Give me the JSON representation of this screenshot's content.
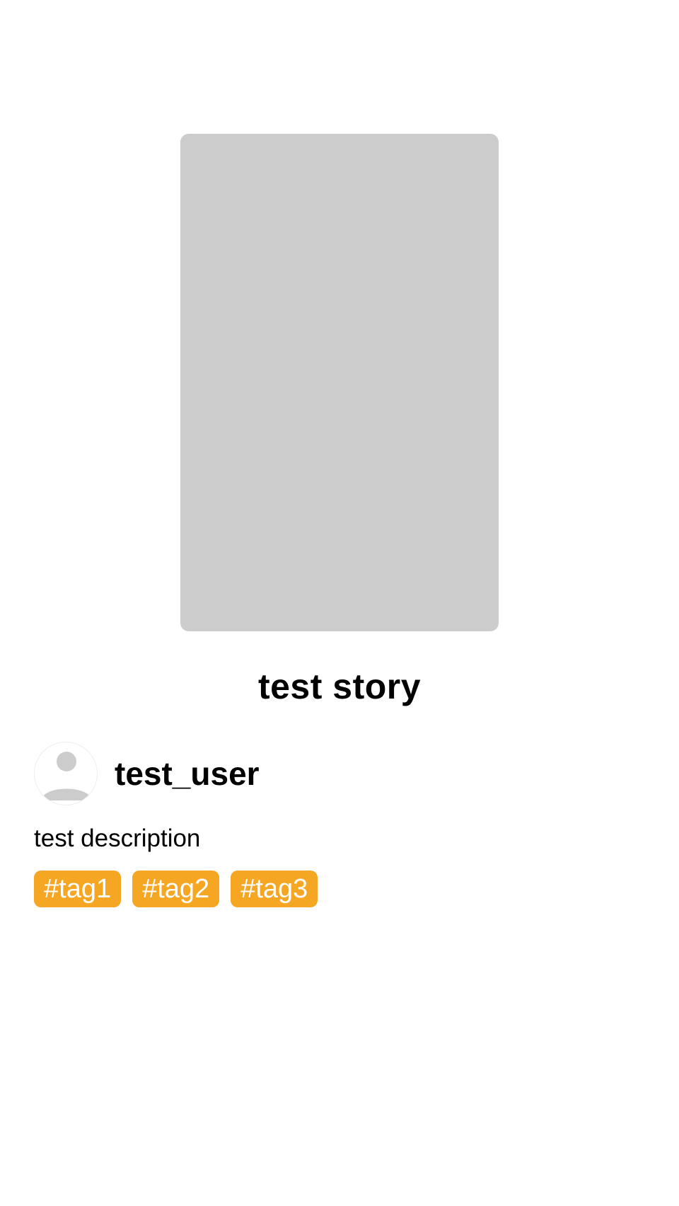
{
  "story": {
    "title": "test story",
    "description": "test description"
  },
  "author": {
    "username": "test_user",
    "avatar_icon": "person-icon"
  },
  "tags": [
    "#tag1",
    "#tag2",
    "#tag3"
  ],
  "colors": {
    "cover_placeholder": "#cccccc",
    "tag_background": "#f5a623",
    "tag_text": "#ffffff",
    "avatar_glyph": "#cccccc"
  }
}
